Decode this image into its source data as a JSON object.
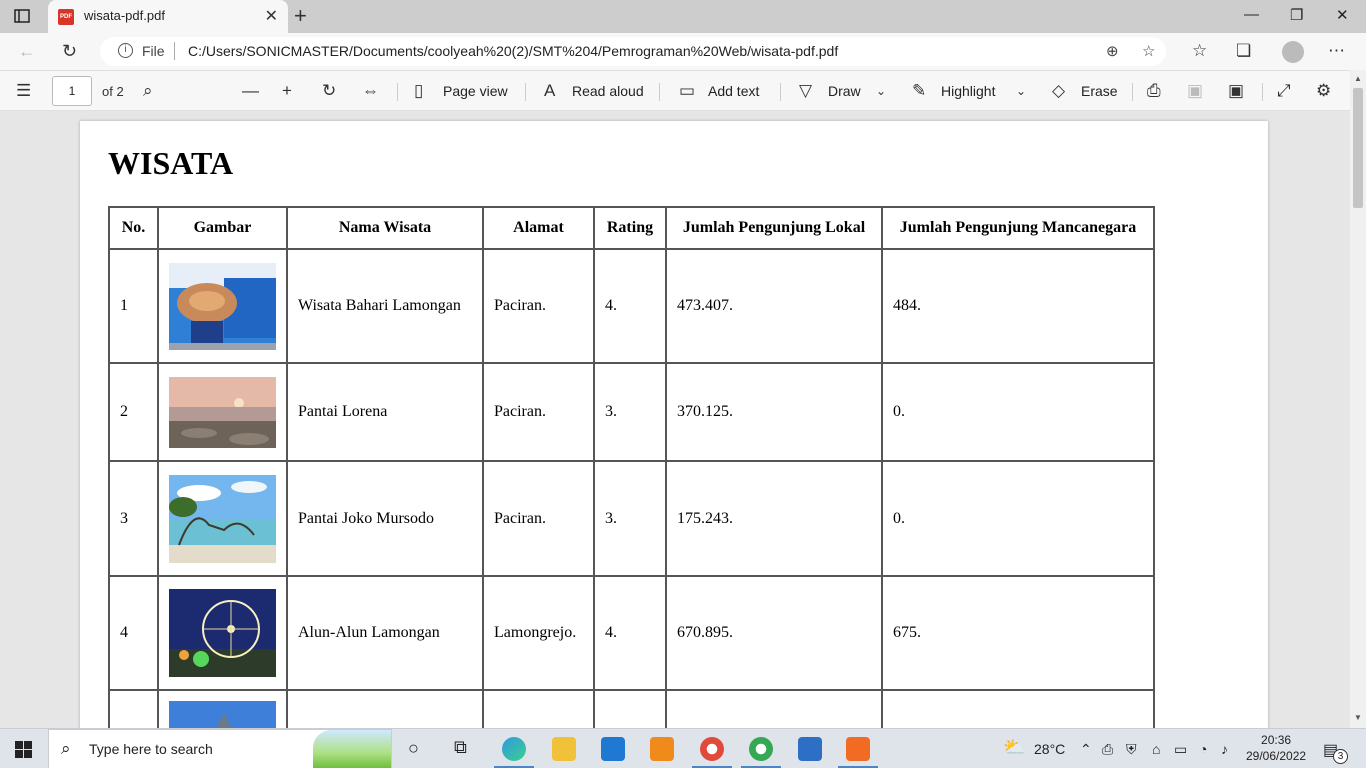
{
  "tab": {
    "title": "wisata-pdf.pdf",
    "close": "✕",
    "new": "+"
  },
  "window": {
    "min": "—",
    "max": "❐",
    "close": "✕"
  },
  "address": {
    "scheme_label": "File",
    "url": "C:/Users/SONICMASTER/Documents/coolyeah%20(2)/SMT%204/Pemrograman%20Web/wisata-pdf.pdf"
  },
  "pdf_toolbar": {
    "page_current": "1",
    "page_total": "of 2",
    "page_view": "Page view",
    "read_aloud": "Read aloud",
    "add_text": "Add text",
    "draw": "Draw",
    "highlight": "Highlight",
    "erase": "Erase"
  },
  "document": {
    "title": "WISATA",
    "headers": [
      "No.",
      "Gambar",
      "Nama Wisata",
      "Alamat",
      "Rating",
      "Jumlah Pengunjung Lokal",
      "Jumlah Pengunjung Mancanegara"
    ],
    "rows": [
      {
        "no": "1",
        "nama": "Wisata Bahari Lamongan",
        "alamat": "Paciran.",
        "rating": "4.",
        "lokal": "473.407.",
        "manca": "484."
      },
      {
        "no": "2",
        "nama": "Pantai Lorena",
        "alamat": "Paciran.",
        "rating": "3.",
        "lokal": "370.125.",
        "manca": "0."
      },
      {
        "no": "3",
        "nama": "Pantai Joko Mursodo",
        "alamat": "Paciran.",
        "rating": "3.",
        "lokal": "175.243.",
        "manca": "0."
      },
      {
        "no": "4",
        "nama": "Alun-Alun Lamongan",
        "alamat": "Lamongrejo.",
        "rating": "4.",
        "lokal": "670.895.",
        "manca": "675."
      }
    ]
  },
  "taskbar": {
    "search_placeholder": "Type here to search",
    "weather": "28°C",
    "time": "20:36",
    "date": "29/06/2022",
    "notifications": "3"
  }
}
